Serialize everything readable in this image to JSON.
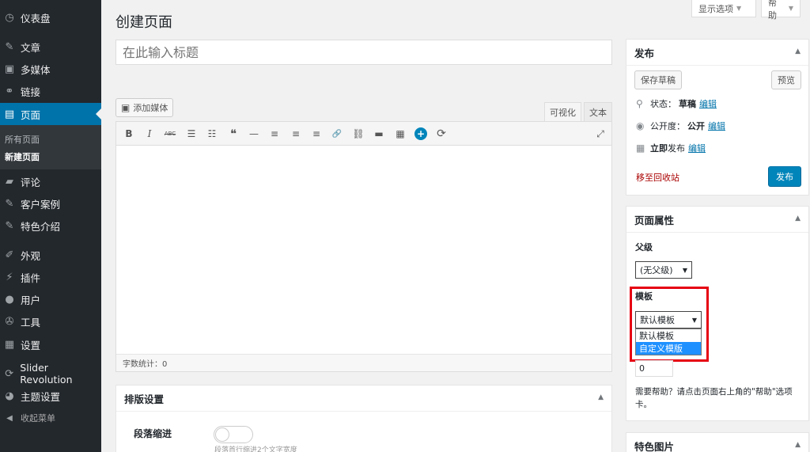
{
  "sidebar": {
    "items": [
      {
        "id": "dashboard",
        "label": "仪表盘",
        "icon": "dashboard-icon",
        "glyph": "◷"
      },
      {
        "id": "posts",
        "label": "文章",
        "icon": "pin-icon",
        "glyph": "✎"
      },
      {
        "id": "media",
        "label": "多媒体",
        "icon": "media-icon",
        "glyph": "▣"
      },
      {
        "id": "links",
        "label": "链接",
        "icon": "link-icon",
        "glyph": "⚭"
      },
      {
        "id": "pages",
        "label": "页面",
        "icon": "pages-icon",
        "glyph": "▤"
      },
      {
        "id": "comments",
        "label": "评论",
        "icon": "comment-icon",
        "glyph": "▰"
      },
      {
        "id": "cases",
        "label": "客户案例",
        "icon": "pin-icon",
        "glyph": "✎"
      },
      {
        "id": "features",
        "label": "特色介绍",
        "icon": "pin-icon",
        "glyph": "✎"
      },
      {
        "id": "appearance",
        "label": "外观",
        "icon": "brush-icon",
        "glyph": "✐"
      },
      {
        "id": "plugins",
        "label": "插件",
        "icon": "plugin-icon",
        "glyph": "⚡"
      },
      {
        "id": "users",
        "label": "用户",
        "icon": "user-icon",
        "glyph": "●"
      },
      {
        "id": "tools",
        "label": "工具",
        "icon": "wrench-icon",
        "glyph": "✇"
      },
      {
        "id": "settings",
        "label": "设置",
        "icon": "settings-icon",
        "glyph": "▦"
      },
      {
        "id": "slider",
        "label": "Slider Revolution",
        "icon": "refresh-icon",
        "glyph": "⟳"
      },
      {
        "id": "theme",
        "label": "主题设置",
        "icon": "theme-icon",
        "glyph": "◕"
      },
      {
        "id": "collapse",
        "label": "收起菜单",
        "icon": "collapse-icon",
        "glyph": "◀"
      }
    ],
    "submenu": [
      "所有页面",
      "新建页面"
    ]
  },
  "screen_options": {
    "label": "显示选项"
  },
  "help": {
    "label": "帮助"
  },
  "page_title": "创建页面",
  "title_placeholder": "在此输入标题",
  "editor": {
    "add_media": "添加媒体",
    "tab_visual": "可视化",
    "tab_text": "文本",
    "toolbar": [
      {
        "name": "bold-icon",
        "glyph": "B"
      },
      {
        "name": "italic-icon",
        "glyph": "I"
      },
      {
        "name": "strikethrough-icon",
        "glyph": "ABC"
      },
      {
        "name": "bullet-list-icon",
        "glyph": "☰"
      },
      {
        "name": "numbered-list-icon",
        "glyph": "☷"
      },
      {
        "name": "blockquote-icon",
        "glyph": "❝"
      },
      {
        "name": "horizontal-rule-icon",
        "glyph": "—"
      },
      {
        "name": "align-left-icon",
        "glyph": "≡"
      },
      {
        "name": "align-center-icon",
        "glyph": "≡"
      },
      {
        "name": "align-right-icon",
        "glyph": "≡"
      },
      {
        "name": "insert-link-icon",
        "glyph": "🔗"
      },
      {
        "name": "unlink-icon",
        "glyph": "⛓"
      },
      {
        "name": "read-more-icon",
        "glyph": "▬"
      },
      {
        "name": "toolbar-toggle-icon",
        "glyph": "▦"
      },
      {
        "name": "add-plus-icon",
        "glyph": "+"
      },
      {
        "name": "refresh-icon",
        "glyph": "⟳"
      },
      {
        "name": "fullscreen-icon",
        "glyph": "⤢"
      }
    ],
    "word_count": "字数统计：0"
  },
  "layout_box": {
    "title": "排版设置",
    "para_indent_label": "段落缩进",
    "para_indent_desc": "段落首行缩进2个文字宽度"
  },
  "publish": {
    "title": "发布",
    "save_draft": "保存草稿",
    "preview": "预览",
    "status_label": "状态：",
    "status_value": "草稿",
    "visibility_label": "公开度：",
    "visibility_value": "公开",
    "schedule_label": "立即",
    "schedule_suffix": "发布",
    "edit": "编辑",
    "trash": "移至回收站",
    "publish_btn": "发布"
  },
  "page_attributes": {
    "title": "页面属性",
    "parent_label": "父级",
    "parent_value": "(无父级)",
    "template_label": "模板",
    "template_value": "默认模板",
    "template_options": [
      "默认模板",
      "自定义模版"
    ],
    "order_value": "0",
    "help_text": "需要帮助？请点击页面右上角的\"帮助\"选项卡。"
  },
  "featured_image": {
    "title": "特色图片"
  },
  "colors": {
    "accent": "#0073aa",
    "sidebar": "#23282d",
    "highlight_box": "#e60012"
  }
}
